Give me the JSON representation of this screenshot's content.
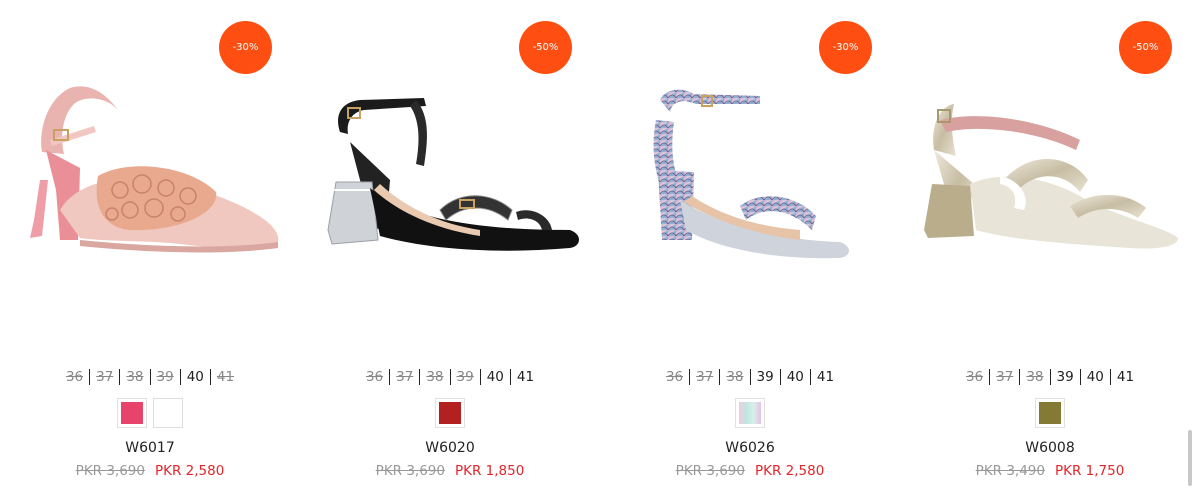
{
  "products": [
    {
      "discount": "-30%",
      "sizes": [
        {
          "label": "36",
          "available": false
        },
        {
          "label": "37",
          "available": false
        },
        {
          "label": "38",
          "available": false
        },
        {
          "label": "39",
          "available": false
        },
        {
          "label": "40",
          "available": true
        },
        {
          "label": "41",
          "available": false
        }
      ],
      "swatches": [
        "#e8436a",
        "#ffffff"
      ],
      "sku": "W6017",
      "old_price": "PKR 3,690",
      "new_price": "PKR 2,580",
      "image_icon": "pink-floral-block-heel-sandal"
    },
    {
      "discount": "-50%",
      "sizes": [
        {
          "label": "36",
          "available": false
        },
        {
          "label": "37",
          "available": false
        },
        {
          "label": "38",
          "available": false
        },
        {
          "label": "39",
          "available": false
        },
        {
          "label": "40",
          "available": true
        },
        {
          "label": "41",
          "available": true
        }
      ],
      "swatches": [
        "#b32020"
      ],
      "sku": "W6020",
      "old_price": "PKR 3,690",
      "new_price": "PKR 1,850",
      "image_icon": "black-clear-heel-sandal"
    },
    {
      "discount": "-30%",
      "sizes": [
        {
          "label": "36",
          "available": false
        },
        {
          "label": "37",
          "available": false
        },
        {
          "label": "38",
          "available": false
        },
        {
          "label": "39",
          "available": true
        },
        {
          "label": "40",
          "available": true
        },
        {
          "label": "41",
          "available": true
        }
      ],
      "swatches": [
        "multicolor"
      ],
      "sku": "W6026",
      "old_price": "PKR 3,690",
      "new_price": "PKR 2,580",
      "image_icon": "snakeskin-block-heel-sandal"
    },
    {
      "discount": "-50%",
      "sizes": [
        {
          "label": "36",
          "available": false
        },
        {
          "label": "37",
          "available": false
        },
        {
          "label": "38",
          "available": false
        },
        {
          "label": "39",
          "available": true
        },
        {
          "label": "40",
          "available": true
        },
        {
          "label": "41",
          "available": true
        }
      ],
      "swatches": [
        "#857a35"
      ],
      "sku": "W6008",
      "old_price": "PKR 3,490",
      "new_price": "PKR 1,750",
      "image_icon": "gold-metallic-block-heel-sandal"
    }
  ],
  "colors": {
    "badge": "#ff4e12",
    "sale_price": "#e3252b",
    "old_price": "#999999"
  }
}
